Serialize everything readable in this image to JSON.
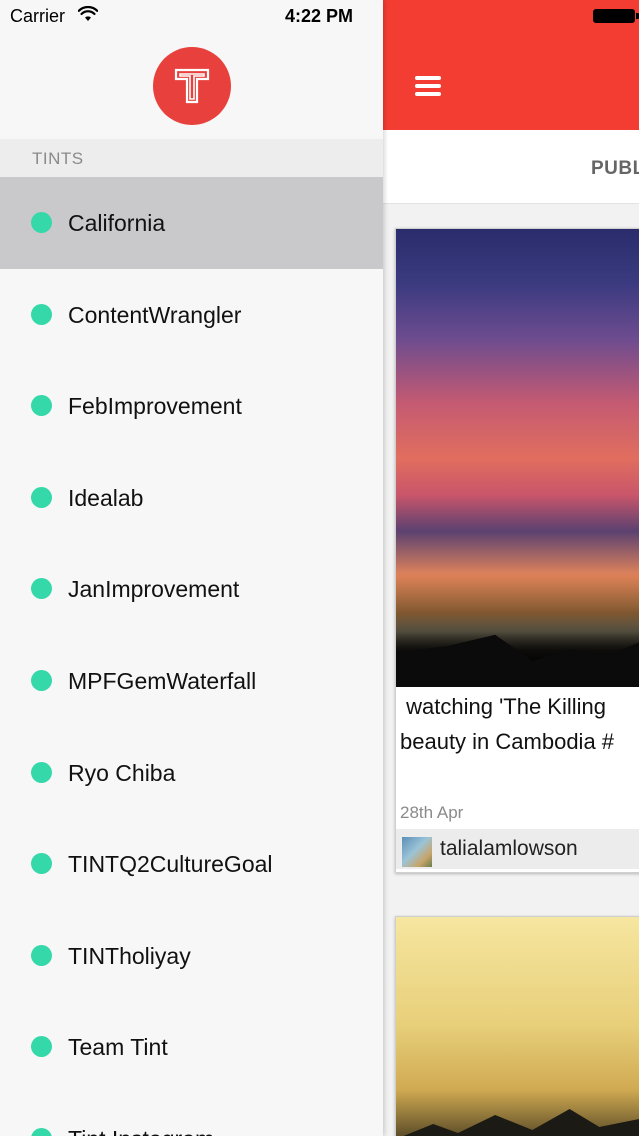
{
  "status_bar": {
    "carrier": "Carrier",
    "time": "4:22 PM"
  },
  "drawer": {
    "logo_icon": "tint-t-logo-icon",
    "section_title": "TINTS",
    "accent_color": "#e8403c",
    "dot_color": "#35d8a9",
    "items": [
      {
        "label": "California",
        "selected": true
      },
      {
        "label": "ContentWrangler",
        "selected": false
      },
      {
        "label": "FebImprovement",
        "selected": false
      },
      {
        "label": "Idealab",
        "selected": false
      },
      {
        "label": "JanImprovement",
        "selected": false
      },
      {
        "label": "MPFGemWaterfall",
        "selected": false
      },
      {
        "label": "Ryo Chiba",
        "selected": false
      },
      {
        "label": "TINTQ2CultureGoal",
        "selected": false
      },
      {
        "label": "TINTholiyay",
        "selected": false
      },
      {
        "label": "Team Tint",
        "selected": false
      },
      {
        "label": "Tint Instagram",
        "selected": false
      }
    ]
  },
  "main": {
    "header_color": "#f33d33",
    "menu_icon": "hamburger-menu-icon",
    "tab_label": "PUBL",
    "posts": [
      {
        "caption": " watching 'The Killing\nbeauty in Cambodia #",
        "date": "28th Apr",
        "author": "talialamlowson"
      }
    ]
  }
}
